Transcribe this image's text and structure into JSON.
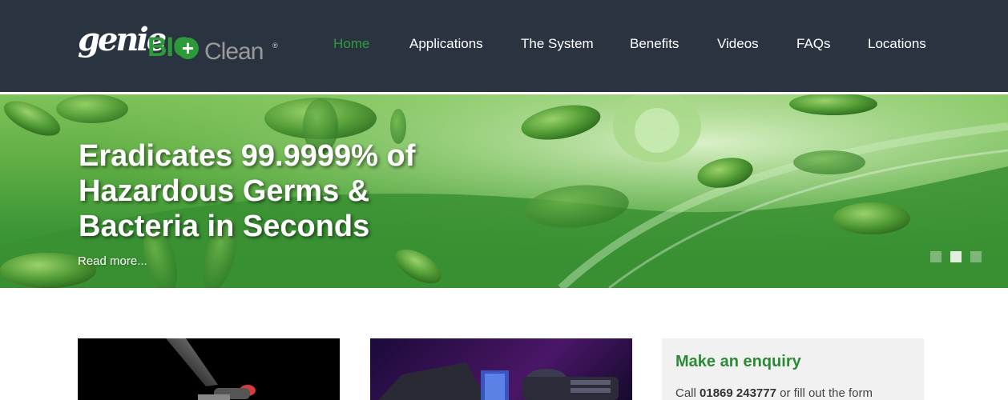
{
  "brand": {
    "logo_part_1": "genie",
    "logo_part_2": "BIO",
    "logo_part_3": "Clean",
    "logo_plus": "+",
    "logo_registered": "®",
    "colors": {
      "header_bg": "#2a3441",
      "accent_green": "#2e9b3c",
      "logo_gray": "#9a9a9a"
    }
  },
  "nav": {
    "items": [
      {
        "label": "Home",
        "active": true
      },
      {
        "label": "Applications",
        "active": false
      },
      {
        "label": "The System",
        "active": false
      },
      {
        "label": "Benefits",
        "active": false
      },
      {
        "label": "Videos",
        "active": false
      },
      {
        "label": "FAQs",
        "active": false
      },
      {
        "label": "Locations",
        "active": false
      }
    ]
  },
  "hero": {
    "title_line_1": "Eradicates 99.9999% of",
    "title_line_2": "Hazardous Germs &",
    "title_line_3": "Bacteria in Seconds",
    "link": "Read more...",
    "slides_count": 3,
    "active_slide": 2
  },
  "enquiry": {
    "title": "Make an enquiry",
    "text_prefix": "Call ",
    "phone": "01869 243777",
    "text_suffix": " or fill out the form"
  }
}
